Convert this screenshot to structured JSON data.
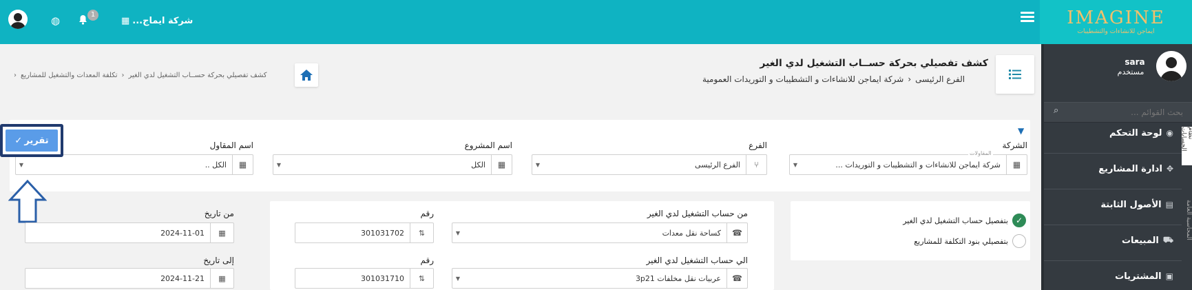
{
  "app": {
    "logo_main": "IMAGINE",
    "logo_sub": "ايماجن للانشاءات والتشطيبات",
    "company_short": "شركة ايماج...",
    "notification_count": "1"
  },
  "user": {
    "name": "sara",
    "role": "مستخدم"
  },
  "sidebar": {
    "search_placeholder": "بحث القوائم ...",
    "items": [
      {
        "label": "لوحة التحكم",
        "icon": "dashboard-icon"
      },
      {
        "label": "ادارة المشاريع",
        "icon": "handshake-icon"
      },
      {
        "label": "الأصول الثابتة",
        "icon": "document-icon"
      },
      {
        "label": "المبيعات",
        "icon": "truck-icon"
      },
      {
        "label": "المشتريات",
        "icon": "money-icon"
      }
    ],
    "tab_labels": [
      "نظام الحسابات",
      "المحاسبة العامة"
    ]
  },
  "header": {
    "title": "كشف تفصيلي بحركة حســاب التشغيل لدي الغير",
    "breadcrumb_company": "شركة ايماجن للانشاءات و التشطيبات و التوريدات العمومية",
    "breadcrumb_branch": "الفرع الرئيسى"
  },
  "right_breadcrumb": {
    "parent": "تكلفة المعدات والتشغيل للمشاريع",
    "current": "كشف تفصيلي بحركة حســاب التشغيل لدي الغير"
  },
  "filters": {
    "company_label": "الشركة",
    "company_float": "المقاولات",
    "company_value": "شركة ايماجن للانشاءات و التشطيبات و التوريدات ...",
    "branch_label": "الفرع",
    "branch_value": "الفرع الرئيسى",
    "project_label": "اسم المشروع",
    "project_value": "الكل",
    "contractor_label": "اسم المقاول",
    "contractor_value": "الكل ..",
    "report_button": "تقرير"
  },
  "options": {
    "option1": "بتفصيل حساب التشغيل لدي الغير",
    "option2": "بتفصيلي بنود التكلفة للمشاريع"
  },
  "accounts": {
    "from_label": "من حساب التشغيل لدي الغير",
    "from_value": "كساحة نقل معدات",
    "from_number_label": "رقم",
    "from_number": "301031702",
    "to_label": "الي حساب التشغيل لدي الغير",
    "to_value": "عربيات نقل مخلفات 3p21",
    "to_number_label": "رقم",
    "to_number": "301031710"
  },
  "dates": {
    "from_label": "من تاريخ",
    "from_value": "2024-11-01",
    "to_label": "إلى تاريخ",
    "to_value": "2024-11-21"
  },
  "colors": {
    "topbar": "#0fb3c2",
    "sidebar": "#343a40",
    "report_button": "#5a9ce8",
    "highlight_border": "#203a6e",
    "radio_checked": "#2e8b57"
  }
}
